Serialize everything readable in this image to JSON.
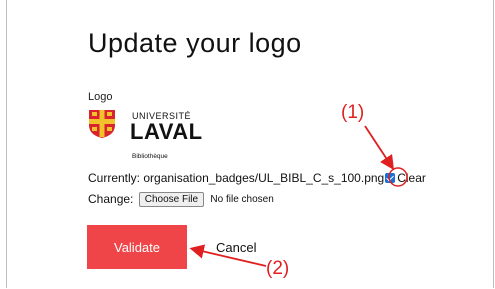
{
  "page": {
    "title": "Update your logo"
  },
  "form": {
    "logo_label": "Logo",
    "logo": {
      "university": "UNIVERSITÉ",
      "name": "LAVAL",
      "subtitle": "Bibliothèque"
    },
    "current_label": "Currently:",
    "current_value": "organisation_badges/UL_BIBL_C_s_100.png",
    "clear_label": "Clear",
    "clear_checked": true,
    "change_label": "Change:",
    "file_button": "Choose File",
    "file_status": "No file chosen",
    "validate_label": "Validate",
    "cancel_label": "Cancel"
  },
  "annotations": {
    "one": "(1)",
    "two": "(2)",
    "color": "#e02020"
  },
  "colors": {
    "validate_bg": "#ef4548",
    "checkbox": "#1a6fd6"
  }
}
